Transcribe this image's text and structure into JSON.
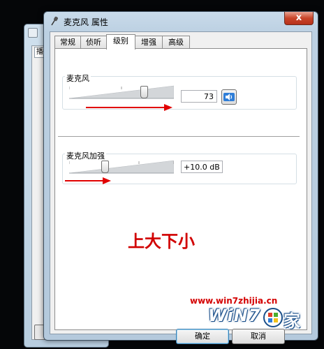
{
  "background_window": {
    "tab_label": "播"
  },
  "window": {
    "title": "麦克风 属性",
    "close_glyph": "x"
  },
  "tabs": [
    {
      "label": "常规",
      "active": false
    },
    {
      "label": "侦听",
      "active": false
    },
    {
      "label": "级别",
      "active": true
    },
    {
      "label": "增强",
      "active": false
    },
    {
      "label": "高级",
      "active": false
    }
  ],
  "microphone": {
    "label": "麦克风",
    "value": "73",
    "level_percent": 73,
    "speaker_icon": "speaker-icon"
  },
  "boost": {
    "label": "麦克风加强",
    "value": "+10.0 dB",
    "level_percent": 33
  },
  "annotation": {
    "text": "上大下小"
  },
  "watermark": {
    "url": "www.win7zhijia.cn",
    "logo_text": "WiN7",
    "logo_char": "家"
  },
  "buttons": {
    "ok": "确定",
    "cancel": "取消"
  },
  "colors": {
    "annotation_red": "#d10000",
    "arrow_red": "#e10000",
    "title_bar": "#c9dbea",
    "close_red": "#c9452a"
  }
}
